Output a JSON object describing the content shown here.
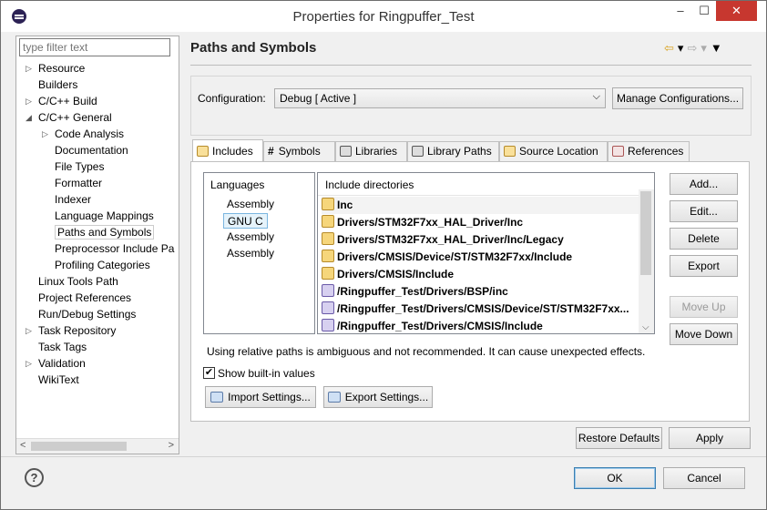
{
  "window": {
    "title": "Properties for Ringpuffer_Test",
    "minimize": "–",
    "maximize": "☐",
    "close": "✕"
  },
  "filter": {
    "placeholder": "type filter text"
  },
  "tree": [
    {
      "label": "Resource",
      "arrow": "▷"
    },
    {
      "label": "Builders",
      "arrow": ""
    },
    {
      "label": "C/C++ Build",
      "arrow": "▷"
    },
    {
      "label": "C/C++ General",
      "arrow": "◢"
    },
    {
      "label": "Code Analysis",
      "arrow": "▷"
    },
    {
      "label": "Documentation",
      "arrow": ""
    },
    {
      "label": "File Types",
      "arrow": ""
    },
    {
      "label": "Formatter",
      "arrow": ""
    },
    {
      "label": "Indexer",
      "arrow": ""
    },
    {
      "label": "Language Mappings",
      "arrow": ""
    },
    {
      "label": "Paths and Symbols",
      "arrow": ""
    },
    {
      "label": "Preprocessor Include Pa",
      "arrow": ""
    },
    {
      "label": "Profiling Categories",
      "arrow": ""
    },
    {
      "label": "Linux Tools Path",
      "arrow": ""
    },
    {
      "label": "Project References",
      "arrow": ""
    },
    {
      "label": "Run/Debug Settings",
      "arrow": ""
    },
    {
      "label": "Task Repository",
      "arrow": "▷"
    },
    {
      "label": "Task Tags",
      "arrow": ""
    },
    {
      "label": "Validation",
      "arrow": "▷"
    },
    {
      "label": "WikiText",
      "arrow": ""
    }
  ],
  "page": {
    "title": "Paths and Symbols",
    "config_label": "Configuration:",
    "config_value": "Debug  [ Active ]",
    "manage_button": "Manage Configurations..."
  },
  "tabs": [
    "Includes",
    "Symbols",
    "Libraries",
    "Library Paths",
    "Source Location",
    "References"
  ],
  "languages": {
    "header": "Languages",
    "items": [
      "Assembly",
      "GNU C",
      "Assembly",
      "Assembly"
    ]
  },
  "includes": {
    "header": "Include directories",
    "items": [
      {
        "path": "Inc",
        "kind": "folder"
      },
      {
        "path": "Drivers/STM32F7xx_HAL_Driver/Inc",
        "kind": "folder"
      },
      {
        "path": "Drivers/STM32F7xx_HAL_Driver/Inc/Legacy",
        "kind": "folder"
      },
      {
        "path": "Drivers/CMSIS/Device/ST/STM32F7xx/Include",
        "kind": "folder"
      },
      {
        "path": "Drivers/CMSIS/Include",
        "kind": "folder"
      },
      {
        "path": "/Ringpuffer_Test/Drivers/BSP/inc",
        "kind": "workspace"
      },
      {
        "path": "/Ringpuffer_Test/Drivers/CMSIS/Device/ST/STM32F7xx...",
        "kind": "workspace"
      },
      {
        "path": "/Ringpuffer_Test/Drivers/CMSIS/Include",
        "kind": "workspace"
      }
    ]
  },
  "side_buttons": [
    "Add...",
    "Edit...",
    "Delete",
    "Export",
    "Move Up",
    "Move Down"
  ],
  "warning": "Using relative paths is ambiguous and not recommended. It can cause unexpected effects.",
  "show_builtin": {
    "label": "Show built-in values",
    "checked": "✔"
  },
  "import_button": "Import Settings...",
  "export_button": "Export Settings...",
  "restore_button": "Restore Defaults",
  "apply_button": "Apply",
  "ok_button": "OK",
  "cancel_button": "Cancel",
  "help_glyph": "?",
  "nav": {
    "back": "⇦",
    "dropdown": "▾",
    "forward": "⇨",
    "menu": "▼"
  }
}
